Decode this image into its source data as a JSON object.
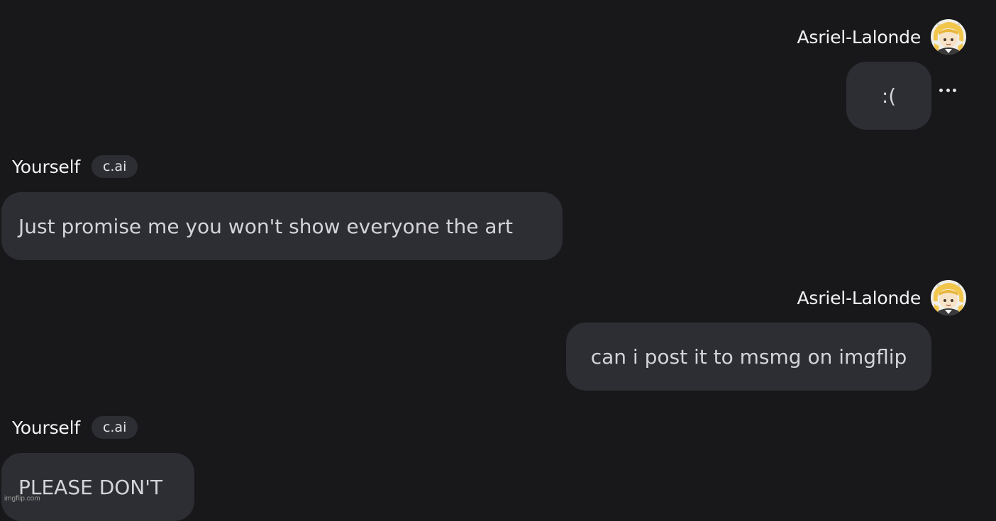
{
  "messages": [
    {
      "role": "user",
      "author": "Asriel-Lalonde",
      "text": ":(",
      "has_more_menu": true,
      "avatar_icon": "character-avatar-icon"
    },
    {
      "role": "character",
      "author": "Yourself",
      "tag": "c.ai",
      "text": "Just promise me you won't show everyone the art"
    },
    {
      "role": "user",
      "author": "Asriel-Lalonde",
      "text": "can i post it to msmg on imgflip",
      "avatar_icon": "character-avatar-icon"
    },
    {
      "role": "character",
      "author": "Yourself",
      "tag": "c.ai",
      "text": "PLEASE DON'T"
    }
  ],
  "more_options_icon": "more-horizontal-icon",
  "watermark": "imgflip.com",
  "colors": {
    "background": "#18181b",
    "bubble": "#2d2e33",
    "text": "#d4d4d8",
    "name": "#f4f4f5"
  }
}
